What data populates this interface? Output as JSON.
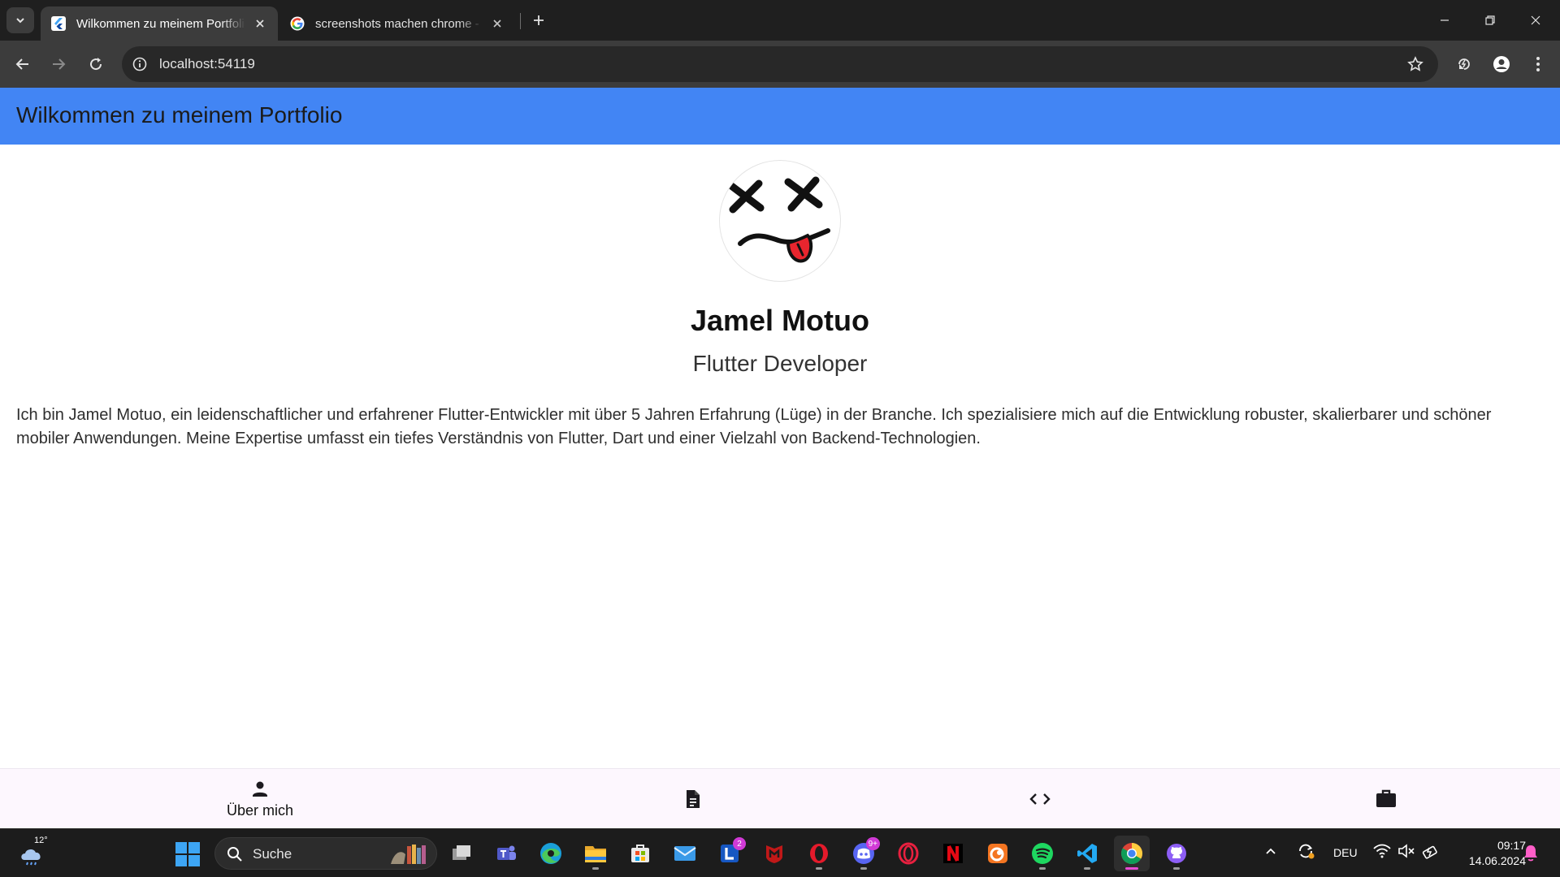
{
  "browser": {
    "tabs": [
      {
        "title": "Wilkommen zu meinem Portfolio",
        "active": true
      },
      {
        "title": "screenshots machen chrome - Google Suche",
        "active": false
      }
    ],
    "url": "localhost:54119"
  },
  "app": {
    "appbar_title": "Wilkommen zu meinem Portfolio",
    "appbar_color": "#4285f4",
    "profile": {
      "name": "Jamel Motuo",
      "role": "Flutter Developer",
      "bio": "Ich bin Jamel Motuo, ein leidenschaftlicher und erfahrener Flutter-Entwickler mit über 5 Jahren Erfahrung (Lüge) in der Branche. Ich spezialisiere mich auf die Entwicklung robuster, skalierbarer und schöner mobiler Anwendungen. Meine Expertise umfasst ein tiefes Verständnis von Flutter, Dart und einer Vielzahl von Backend-Technologien."
    },
    "bottom_nav": [
      {
        "icon": "person-icon",
        "label": "Über mich",
        "selected": true
      },
      {
        "icon": "document-icon",
        "label": "",
        "selected": false
      },
      {
        "icon": "code-icon",
        "label": "",
        "selected": false
      },
      {
        "icon": "briefcase-icon",
        "label": "",
        "selected": false
      }
    ]
  },
  "taskbar": {
    "weather_temp": "12°",
    "search_label": "Suche",
    "apps": [
      {
        "name": "task-view",
        "running": false
      },
      {
        "name": "teams",
        "running": false
      },
      {
        "name": "edge",
        "running": false
      },
      {
        "name": "file-explorer",
        "running": true
      },
      {
        "name": "microsoft-store",
        "running": false
      },
      {
        "name": "mail",
        "running": false
      },
      {
        "name": "l-app",
        "running": false,
        "badge": "2"
      },
      {
        "name": "mcafee",
        "running": false
      },
      {
        "name": "opera",
        "running": true
      },
      {
        "name": "discord",
        "running": true,
        "badge": "9+"
      },
      {
        "name": "opera-gx",
        "running": false
      },
      {
        "name": "netflix",
        "running": false
      },
      {
        "name": "crunchyroll",
        "running": false
      },
      {
        "name": "spotify",
        "running": true
      },
      {
        "name": "vscode",
        "running": true
      },
      {
        "name": "chrome",
        "running": true,
        "active": true
      },
      {
        "name": "github-desktop",
        "running": true
      }
    ],
    "language": "DEU",
    "time": "09:17",
    "date": "14.06.2024"
  }
}
